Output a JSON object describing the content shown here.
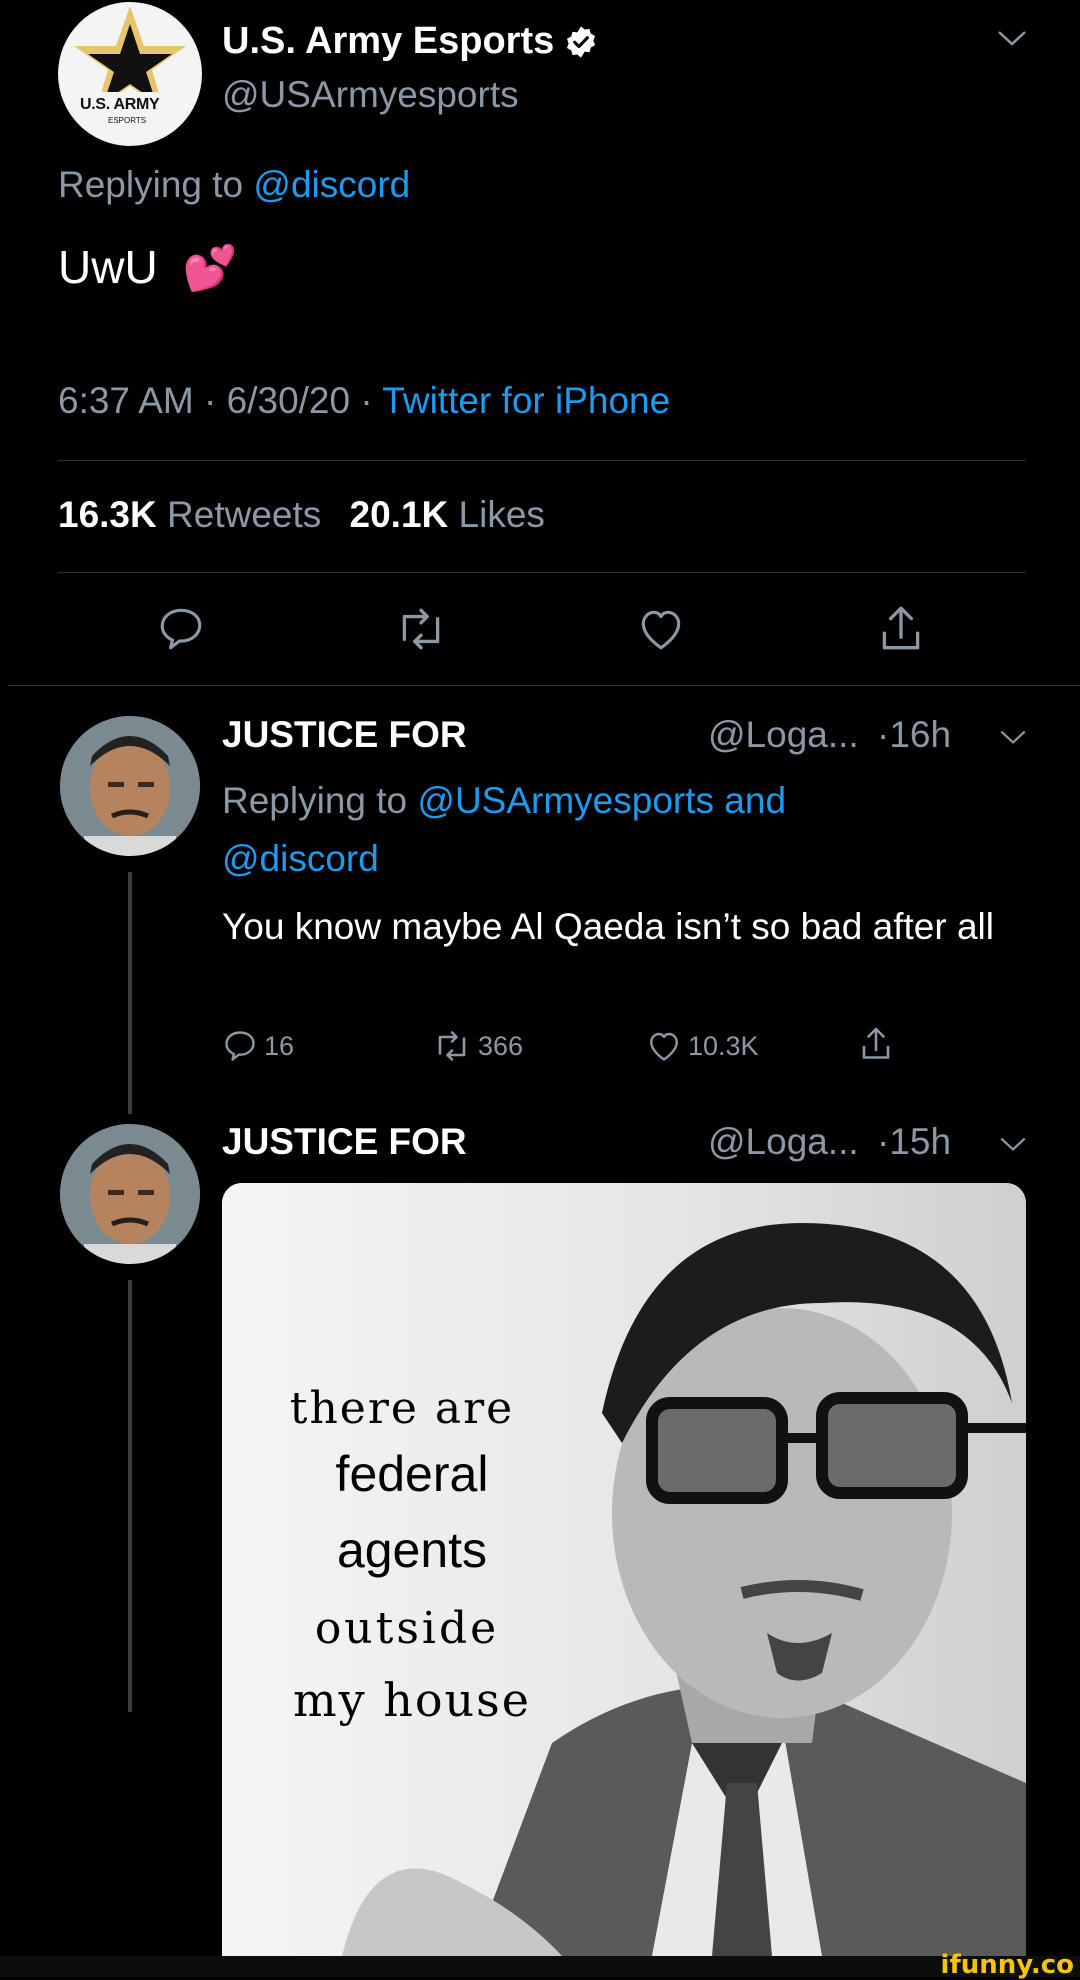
{
  "main_tweet": {
    "display_name": "U.S. Army Esports",
    "handle": "@USArmyesports",
    "avatar_text": "U.S. ARMY",
    "avatar_subtext": "ESPORTS",
    "replying_prefix": "Replying to ",
    "replying_to": "@discord",
    "text": "UwU",
    "emoji": "💕",
    "time": "6:37 AM · 6/30/20 · ",
    "source": "Twitter for iPhone",
    "retweets_count": "16.3K",
    "retweets_label": "Retweets",
    "likes_count": "20.1K",
    "likes_label": "Likes"
  },
  "replies": [
    {
      "display_name": "JUSTICE FOR",
      "handle": "@Loga...",
      "age": "·16h",
      "replying_prefix": "Replying to ",
      "replying_to_1": "@USArmyesports",
      "replying_and": " and",
      "replying_to_2": "@discord",
      "text": "You know maybe Al Qaeda isn’t so bad after all",
      "reply_count": "16",
      "retweet_count": "366",
      "like_count": "10.3K"
    },
    {
      "display_name": "JUSTICE FOR",
      "handle": "@Loga...",
      "age": "·15h",
      "meme_lines": [
        "there are",
        "federal",
        "agents",
        "outside",
        "my house"
      ]
    }
  ],
  "watermark": "ifunny.co",
  "colors": {
    "background": "#000000",
    "accent": "#1d9bf0",
    "muted": "#8b98a5",
    "divider": "#2f3336"
  }
}
